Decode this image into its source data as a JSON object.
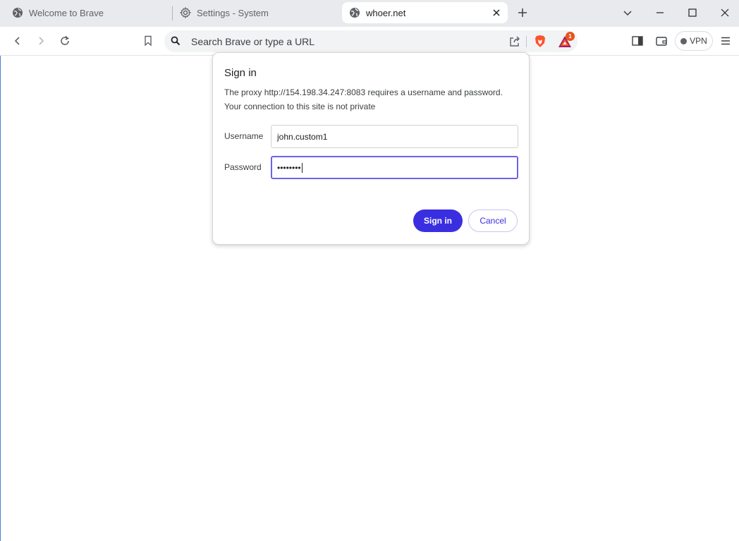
{
  "tabs": [
    {
      "title": "Welcome to Brave",
      "icon": "globe-icon"
    },
    {
      "title": "Settings - System",
      "icon": "gear-icon"
    },
    {
      "title": "whoer.net",
      "icon": "globe-icon",
      "active": true
    }
  ],
  "omnibox": {
    "placeholder": "Search Brave or type a URL"
  },
  "rewards": {
    "badge_count": "1"
  },
  "vpn": {
    "label": "VPN"
  },
  "dialog": {
    "title": "Sign in",
    "message_line1": "The proxy http://154.198.34.247:8083 requires a username and password.",
    "message_line2": "Your connection to this site is not private",
    "username_label": "Username",
    "username_value": "john.custom1",
    "password_label": "Password",
    "password_value": "••••••••",
    "signin_label": "Sign in",
    "cancel_label": "Cancel"
  },
  "colors": {
    "accent": "#3a2fe0",
    "focus_ring": "#6e63e8",
    "tabstrip_bg": "#e8eaed",
    "badge": "#e8541d"
  }
}
